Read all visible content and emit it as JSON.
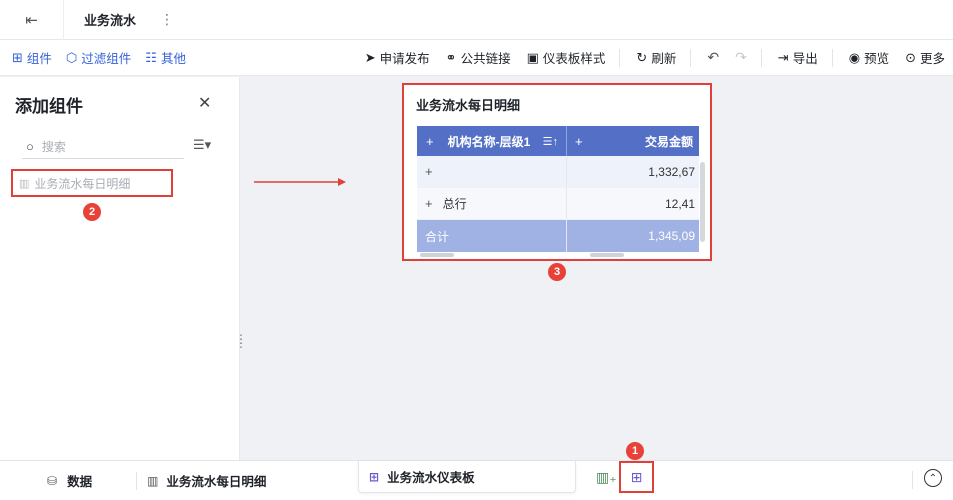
{
  "titlebar": {
    "back_icon": "exit-icon",
    "title": "业务流水",
    "menu_glyph": "⋮"
  },
  "toolbar": {
    "left": [
      {
        "label": "组件",
        "icon": "component-icon"
      },
      {
        "label": "过滤组件",
        "icon": "filter-component-icon"
      },
      {
        "label": "其他",
        "icon": "other-icon"
      }
    ],
    "right": {
      "publish": "申请发布",
      "public_link": "公共链接",
      "dashboard_style": "仪表板样式",
      "refresh": "刷新",
      "export": "导出",
      "preview": "预览",
      "more": "更多"
    },
    "accent_color": "#3461d8"
  },
  "panel": {
    "title": "添加组件",
    "search_placeholder": "搜索",
    "component_item": "业务流水每日明细",
    "badge": "2"
  },
  "widget": {
    "title": "业务流水每日明细",
    "badge": "3",
    "columns": [
      "机构名称-层级1",
      "交易金额"
    ],
    "rows": [
      {
        "name": "",
        "amount": "1,332,67"
      },
      {
        "name": "总行",
        "amount": "12,41"
      }
    ],
    "total": {
      "label": "合计",
      "amount": "1,345,09"
    },
    "header_color": "#5470c6"
  },
  "bottombar": {
    "data_label": "数据",
    "tab_detail": "业务流水每日明细",
    "tab_dashboard": "业务流水仪表板",
    "badge": "1"
  },
  "highlight_color": "#e0403a"
}
